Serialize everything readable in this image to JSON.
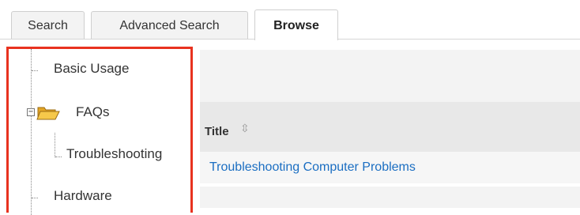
{
  "tabs": [
    {
      "label": "Search",
      "active": false
    },
    {
      "label": "Advanced Search",
      "active": false
    },
    {
      "label": "Browse",
      "active": true
    }
  ],
  "tree": {
    "items": [
      {
        "label": "Basic Usage"
      },
      {
        "label": "FAQs",
        "icon": "folder-open-icon",
        "expanded": true
      },
      {
        "label": "Troubleshooting"
      },
      {
        "label": "Hardware"
      }
    ]
  },
  "table": {
    "column_title": "Title",
    "sort_icon": "⇳",
    "rows": [
      {
        "title": "Troubleshooting Computer Problems"
      }
    ]
  },
  "colors": {
    "highlight_border": "#e8321f",
    "link": "#1b6ec2"
  }
}
